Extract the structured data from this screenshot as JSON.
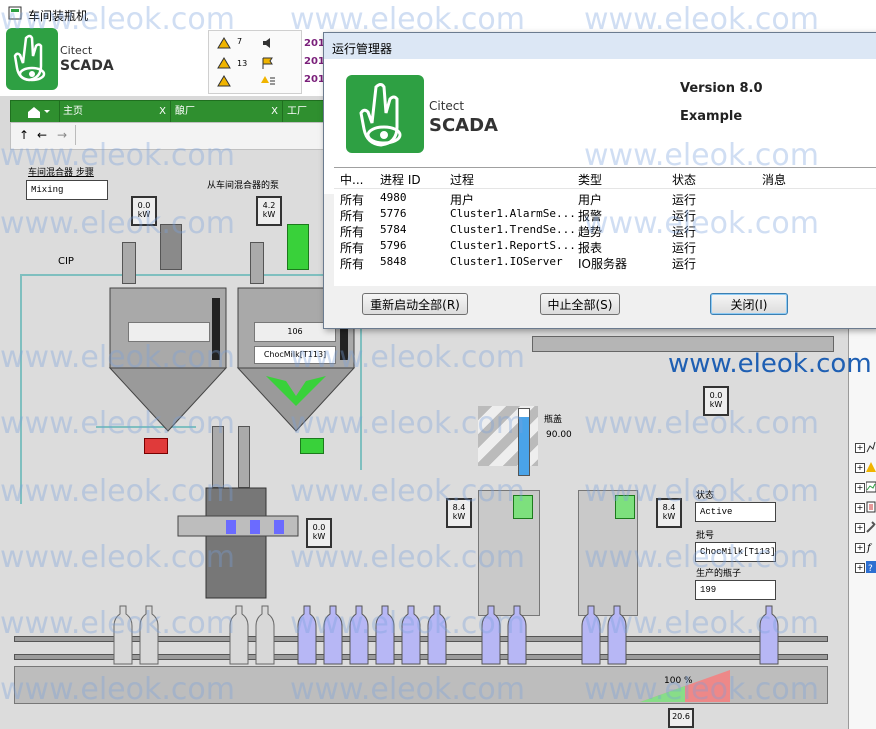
{
  "window": {
    "title": "车间装瓶机"
  },
  "header": {
    "logo_line1": "Citect",
    "logo_line2": "SCADA",
    "alarm_counts": [
      "7",
      "13"
    ],
    "alarm_year_stubs": [
      "201",
      "201",
      "201"
    ]
  },
  "nav": {
    "tabs": [
      "主页",
      "酿厂",
      "工厂"
    ],
    "close_glyph": "X"
  },
  "process": {
    "step_label": "车间混合器 步骤",
    "step_value": "Mixing",
    "pump_label": "从车间混合器的泵",
    "cip_label": "CIP",
    "tank_level": "106",
    "tank_product": "ChocMilk[T113]",
    "level_label": "瓶盖",
    "level_value": "90.00",
    "state_label": "状态",
    "state_value": "Active",
    "recipe_label": "批号",
    "recipe_value": "ChocMilk[T113]",
    "produced_label": "生产的瓶子",
    "produced_value": "199",
    "percent_value": "100 %",
    "meters": [
      {
        "value": "0.0",
        "unit": "kW"
      },
      {
        "value": "4.2",
        "unit": "kW"
      },
      {
        "value": "0.0",
        "unit": "kW"
      },
      {
        "value": "0.0",
        "unit": "kW"
      },
      {
        "value": "8.4",
        "unit": "kW"
      },
      {
        "value": "8.4",
        "unit": "kW"
      },
      {
        "value": "20.6",
        "unit": ""
      }
    ]
  },
  "dialog": {
    "title": "运行管理器",
    "logo_line1": "Citect",
    "logo_line2": "SCADA",
    "version": "Version 8.0",
    "edition": "Example",
    "columns": [
      "中...",
      "进程 ID",
      "过程",
      "类型",
      "状态",
      "消息"
    ],
    "rows": [
      [
        "所有",
        "4980",
        "用户",
        "用户",
        "运行",
        ""
      ],
      [
        "所有",
        "5776",
        "Cluster1.AlarmSe...",
        "报警",
        "运行",
        ""
      ],
      [
        "所有",
        "5784",
        "Cluster1.TrendSe...",
        "趋势",
        "运行",
        ""
      ],
      [
        "所有",
        "5796",
        "Cluster1.ReportS...",
        "报表",
        "运行",
        ""
      ],
      [
        "所有",
        "5848",
        "Cluster1.IOServer",
        "IO服务器",
        "运行",
        ""
      ]
    ],
    "buttons": {
      "restart_all": "重新启动全部(R)",
      "stop_all": "中止全部(S)",
      "close": "关闭(I)"
    }
  },
  "watermark": {
    "text": "www.eleok.com",
    "overlay_text": "www.eleok.com"
  },
  "colors": {
    "brand_green": "#2ea043",
    "nav_green": "#2f8f2f",
    "tank_gray": "#a9a9a9",
    "active_green": "#39d13a",
    "alarm_red": "#e03a3a"
  }
}
